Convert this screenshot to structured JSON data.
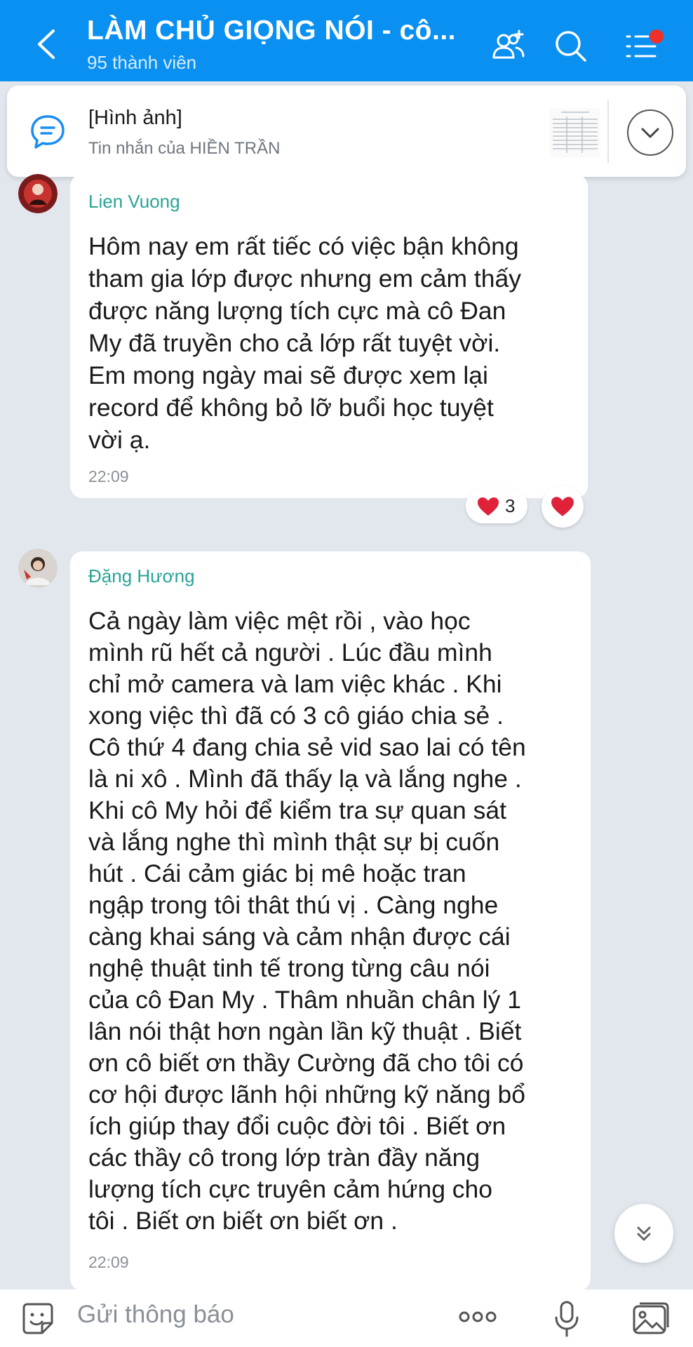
{
  "header": {
    "title": "LÀM CHỦ GIỌNG NÓI - cô...",
    "subtitle": "95 thành viên"
  },
  "pinned": {
    "title": "[Hình ảnh]",
    "subtitle": "Tin nhắn của HIỀN TRẦN"
  },
  "messages": [
    {
      "sender": "Lien Vuong",
      "lines": [
        "Hôm nay em rất tiếc có việc bận không",
        "tham gia lớp được nhưng em cảm thấy",
        "được năng lượng tích cực mà cô Đan",
        "My đã truyền cho cả lớp rất tuyệt vời.",
        "Em mong ngày mai sẽ được xem lại",
        "record để không bỏ lỡ buổi học tuyệt",
        "vời ạ."
      ],
      "time": "22:09",
      "reaction_count": "3"
    },
    {
      "sender": "Đặng Hương",
      "lines": [
        "Cả ngày  làm việc mệt  rồi  , vào học",
        "mình  rũ hết cả người . Lúc đầu mình",
        "chỉ mở camera và lam việc khác . Khi",
        "xong việc thì đã có 3 cô giáo chia sẻ .",
        "Cô thứ 4 đang chia sẻ vid sao lai có tên",
        "là ni xô . Mình đã thấy lạ và lắng nghe  .",
        "Khi cô My hỏi  để kiểm tra sự quan sát",
        "và lắng nghe thì mình thật sự bị cuốn",
        "hút  . Cái cảm giác bị mê hoặc tran",
        "ngập trong tôi thât thú vị . Càng nghe",
        "càng khai sáng  và cảm nhận được cái",
        "nghệ thuật  tinh tế trong từng câu nói",
        "của cô Đan My . Thâm nhuần chân lý 1",
        "lân nói thật hơn ngàn lần kỹ thuật . Biết",
        "ơn cô biết ơn thầy Cường đã cho tôi có",
        "cơ hội được lãnh hội những kỹ năng bổ",
        "ích giúp thay đổi cuộc đời tôi . Biết ơn",
        "các thầy cô trong lớp tràn đầy năng",
        "lượng tích cực truyên cảm hứng cho",
        "tôi . Biết ơn biết ơn biết ơn ."
      ],
      "time": "22:09"
    }
  ],
  "input": {
    "placeholder": "Gửi thông báo"
  },
  "colors": {
    "header_bg": "#0a90f0",
    "sender_name": "#2aa396",
    "heart": "#e0213a",
    "notification_dot": "#f0302b"
  },
  "icons": [
    "back-arrow-icon",
    "add-member-icon",
    "search-icon",
    "menu-icon",
    "pinned-message-icon",
    "chevron-down-icon",
    "heart-icon",
    "double-chevron-down-icon",
    "sticker-icon",
    "more-icon",
    "microphone-icon",
    "image-icon"
  ]
}
